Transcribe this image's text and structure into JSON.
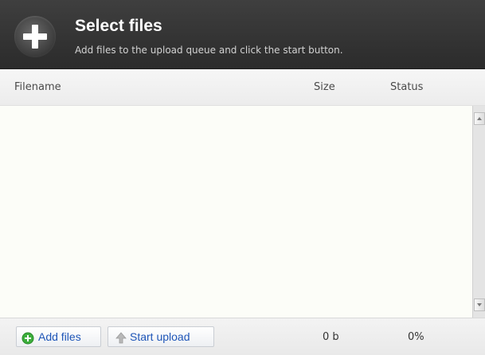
{
  "header": {
    "title": "Select files",
    "subtitle": "Add files to the upload queue and click the start button.",
    "icon": "plus-circle-icon"
  },
  "columns": {
    "filename": "Filename",
    "size": "Size",
    "status": "Status"
  },
  "file_list": {
    "items": []
  },
  "footer": {
    "add_files_label": "Add files",
    "add_files_icon": "add-circle-icon",
    "start_upload_label": "Start upload",
    "start_upload_icon": "upload-arrow-icon",
    "total_size": "0 b",
    "total_percent": "0%"
  },
  "colors": {
    "header_bg": "#333333",
    "link_blue": "#1f56b8",
    "add_icon_green": "#3cae3c"
  }
}
